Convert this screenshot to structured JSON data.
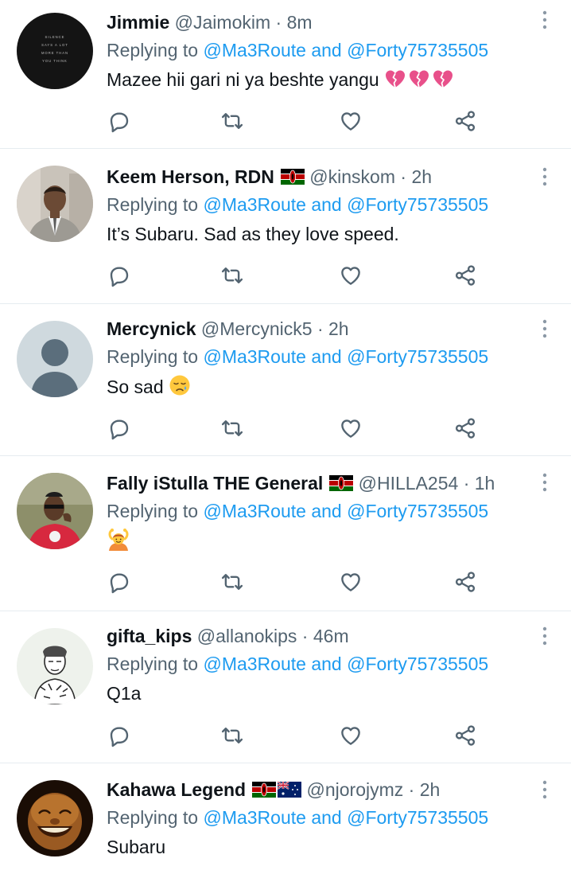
{
  "reply_to": {
    "prefix": "Replying to",
    "mention1": "@Ma3Route",
    "and": "and",
    "mention2": "@Forty75735505"
  },
  "separator": "·",
  "tweets": [
    {
      "name": "Jimmie",
      "handle": "@Jaimokim",
      "time": "8m",
      "text": "Mazee hii gari ni ya beshte yangu",
      "emoji": "broken-heart-x3",
      "flags": [],
      "avatar_text": [
        "SILENCE",
        "SAYS A LOT",
        "MORE THAN",
        "YOU THINK"
      ]
    },
    {
      "name": "Keem Herson, RDN",
      "handle": "@kinskom",
      "time": "2h",
      "text": "It’s Subaru. Sad as they love speed.",
      "flags": [
        "kenya-flag"
      ]
    },
    {
      "name": "Mercynick",
      "handle": "@Mercynick5",
      "time": "2h",
      "text": "So sad",
      "emoji": "sad-face",
      "flags": []
    },
    {
      "name": "Fally iStulla THE General",
      "handle": "@HILLA254",
      "time": "1h",
      "text": "",
      "emoji": "person-gesturing-ok",
      "flags": [
        "kenya-flag"
      ]
    },
    {
      "name": "gifta_kips",
      "handle": "@allanokips",
      "time": "46m",
      "text": "Q1a",
      "flags": []
    },
    {
      "name": "Kahawa Legend",
      "handle": "@njorojymz",
      "time": "2h",
      "text": "Subaru",
      "flags": [
        "kenya-flag",
        "australia-flag"
      ]
    }
  ],
  "icons": {
    "reply": "reply-icon",
    "retweet": "retweet-icon",
    "like": "like-icon",
    "share": "share-icon",
    "more": "more-options-icon"
  },
  "colors": {
    "link": "#1d9bf0",
    "secondary_text": "#536471",
    "divider": "#e6ecf0",
    "icon": "#536471"
  }
}
